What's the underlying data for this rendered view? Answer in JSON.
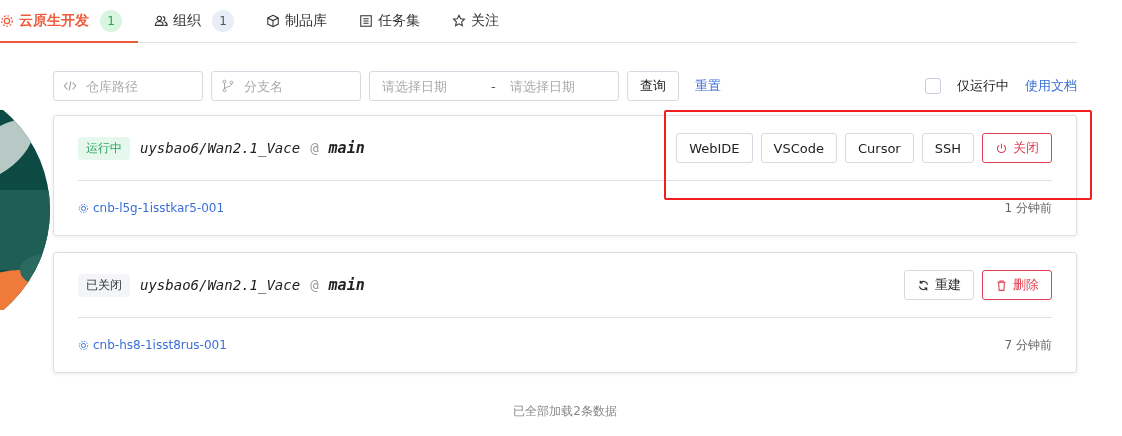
{
  "tabs": [
    {
      "label": "云原生开发",
      "count": "1",
      "selected": true
    },
    {
      "label": "组织",
      "count": "1",
      "selected": false
    },
    {
      "label": "制品库",
      "selected": false
    },
    {
      "label": "任务集",
      "selected": false
    },
    {
      "label": "关注",
      "selected": false
    }
  ],
  "filters": {
    "repo_placeholder": "仓库路径",
    "branch_placeholder": "分支名",
    "start_placeholder": "请选择日期",
    "separator": "-",
    "end_placeholder": "请选择日期",
    "query": "查询",
    "reset": "重置",
    "running_only": {
      "label": "仅运行中",
      "checked": false
    },
    "docs": "使用文档"
  },
  "workspaces": [
    {
      "kind": "running",
      "status_label": "运行中",
      "repo": "uysbao6/Wan2.1_Vace",
      "at": "@",
      "branch": "main",
      "highlighted": true,
      "actions": [
        {
          "kind": "open",
          "label": "WebIDE"
        },
        {
          "kind": "open",
          "label": "VSCode"
        },
        {
          "kind": "open",
          "label": "Cursor"
        },
        {
          "kind": "open",
          "label": "SSH"
        },
        {
          "kind": "stop",
          "label": "关闭"
        }
      ],
      "id": "cnb-l5g-1isstkar5-001",
      "time": "1 分钟前"
    },
    {
      "kind": "closed",
      "status_label": "已关闭",
      "repo": "uysbao6/Wan2.1_Vace",
      "at": "@",
      "branch": "main",
      "highlighted": false,
      "actions": [
        {
          "kind": "rebuild",
          "label": "重建"
        },
        {
          "kind": "delete",
          "label": "删除"
        }
      ],
      "id": "cnb-hs8-1isst8rus-001",
      "time": "7 分钟前"
    }
  ],
  "footer": "已全部加载2条数据"
}
